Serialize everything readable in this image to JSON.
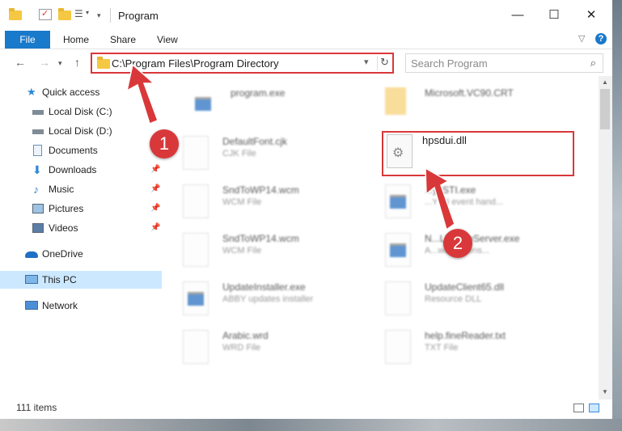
{
  "window": {
    "title": "Program",
    "controls": {
      "minimize": "—",
      "maximize": "☐",
      "close": "✕"
    }
  },
  "ribbon": {
    "tabs": [
      "File",
      "Home",
      "Share",
      "View"
    ],
    "help_icon": "?",
    "expand_icon": "chevron-down-icon"
  },
  "address_bar": {
    "path": "C:\\Program Files\\Program Directory",
    "refresh_icon": "refresh-icon"
  },
  "search": {
    "placeholder": "Search Program"
  },
  "sidebar": {
    "items": [
      {
        "label": "Quick access",
        "icon": "star-icon",
        "pinned": false
      },
      {
        "label": "Local Disk (C:)",
        "icon": "drive-icon",
        "pinned": false
      },
      {
        "label": "Local Disk (D:)",
        "icon": "drive-icon",
        "pinned": false
      },
      {
        "label": "Documents",
        "icon": "document-icon",
        "pinned": false
      },
      {
        "label": "Downloads",
        "icon": "download-icon",
        "pinned": true
      },
      {
        "label": "Music",
        "icon": "music-icon",
        "pinned": true
      },
      {
        "label": "Pictures",
        "icon": "pictures-icon",
        "pinned": true
      },
      {
        "label": "Videos",
        "icon": "videos-icon",
        "pinned": true
      },
      {
        "label": "OneDrive",
        "icon": "cloud-icon",
        "pinned": false
      },
      {
        "label": "This PC",
        "icon": "computer-icon",
        "pinned": false,
        "selected": true
      },
      {
        "label": "Network",
        "icon": "network-icon",
        "pinned": false
      }
    ]
  },
  "files": [
    {
      "name": "program.exe",
      "type": ""
    },
    {
      "name": "Microsoft.VC90.CRT",
      "type": ""
    },
    {
      "name": "DefaultFont.cjk",
      "type": "CJK File"
    },
    {
      "name": "hpsdui.dll",
      "type": ""
    },
    {
      "name": "SndToWP14.wcm",
      "type": "WCM File"
    },
    {
      "name": "...yySTI.exe",
      "type": "...Y sti event hand..."
    },
    {
      "name": "SndToWP14.wcm",
      "type": "WCM File"
    },
    {
      "name": "N...LicenseServer.exe",
      "type": "A...work licens..."
    },
    {
      "name": "UpdateInstaller.exe",
      "type": "ABBY updates installer"
    },
    {
      "name": "UpdateClient65.dll",
      "type": "Resource DLL"
    },
    {
      "name": "Arabic.wrd",
      "type": "WRD File"
    },
    {
      "name": "help.fineReader.txt",
      "type": "TXT File"
    }
  ],
  "status_bar": {
    "item_count": "111 items"
  },
  "annotations": {
    "step1": "1",
    "step2": "2",
    "color": "#d9383a"
  }
}
